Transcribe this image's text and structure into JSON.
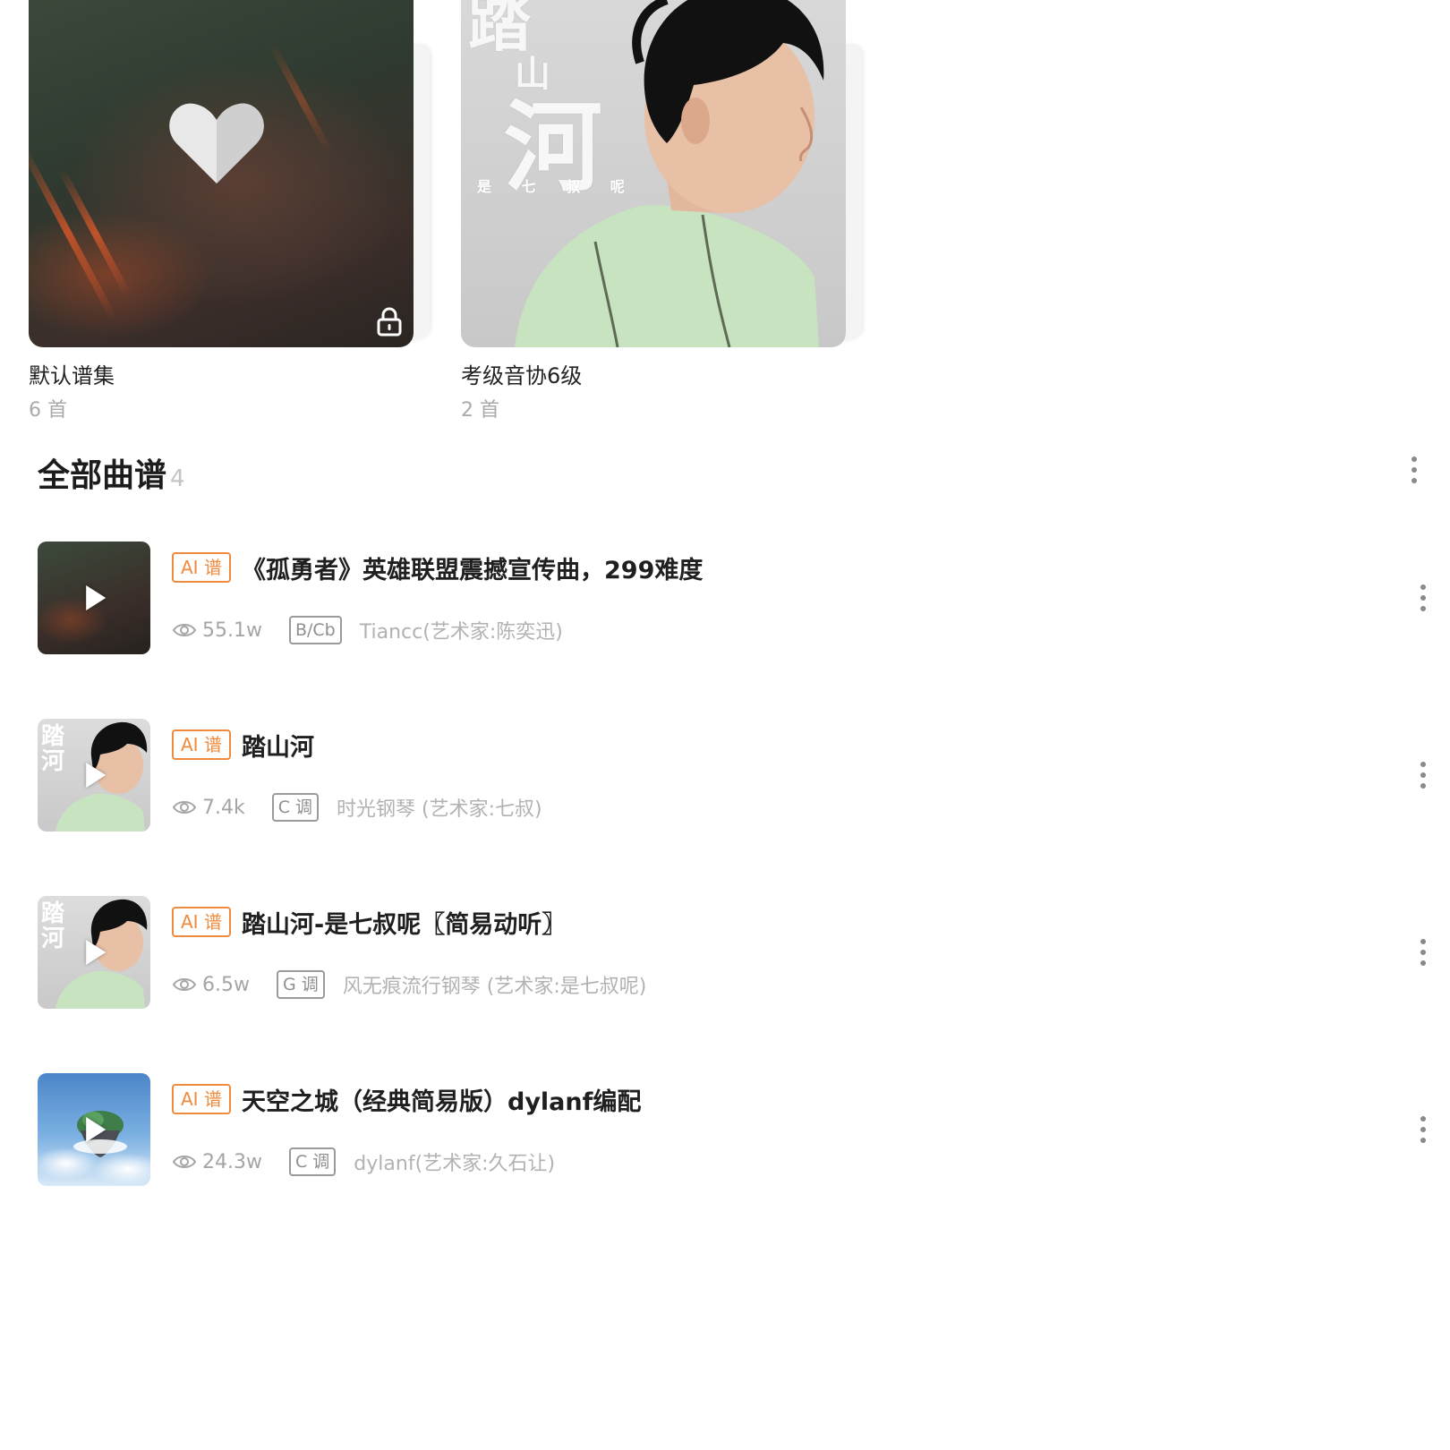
{
  "albums": [
    {
      "name": "默认谱集",
      "count": "6 首",
      "locked": true,
      "cover_icon": "heart-icon"
    },
    {
      "name": "考级音协6级",
      "count": "2 首",
      "cover_text": [
        "踏",
        "山",
        "河",
        "是 七 叔 呢"
      ]
    }
  ],
  "section": {
    "title": "全部曲谱",
    "count": "4",
    "more_icon": "more-vertical-icon"
  },
  "songs": [
    {
      "badge": "AI 谱",
      "title": "《孤勇者》英雄联盟震撼宣传曲，299难度",
      "views": "55.1w",
      "key": "B/Cb",
      "arranger": "Tiancc(艺术家:陈奕迅)",
      "thumb": "dark"
    },
    {
      "badge": "AI 谱",
      "title": "踏山河",
      "views": "7.4k",
      "key": "C 调",
      "arranger": "时光钢琴 (艺术家:七叔)",
      "thumb": "gray"
    },
    {
      "badge": "AI 谱",
      "title": "踏山河-是七叔呢〖简易动听〗",
      "views": "6.5w",
      "key": "G 调",
      "arranger": "风无痕流行钢琴 (艺术家:是七叔呢)",
      "thumb": "gray"
    },
    {
      "badge": "AI 谱",
      "title": "天空之城（经典简易版）dylanf编配",
      "views": "24.3w",
      "key": "C 调",
      "arranger": "dylanf(艺术家:久石让)",
      "thumb": "sky"
    }
  ],
  "colors": {
    "accent": "#f08a3c",
    "title": "#1f1f1f",
    "muted": "#a5a5a5"
  }
}
